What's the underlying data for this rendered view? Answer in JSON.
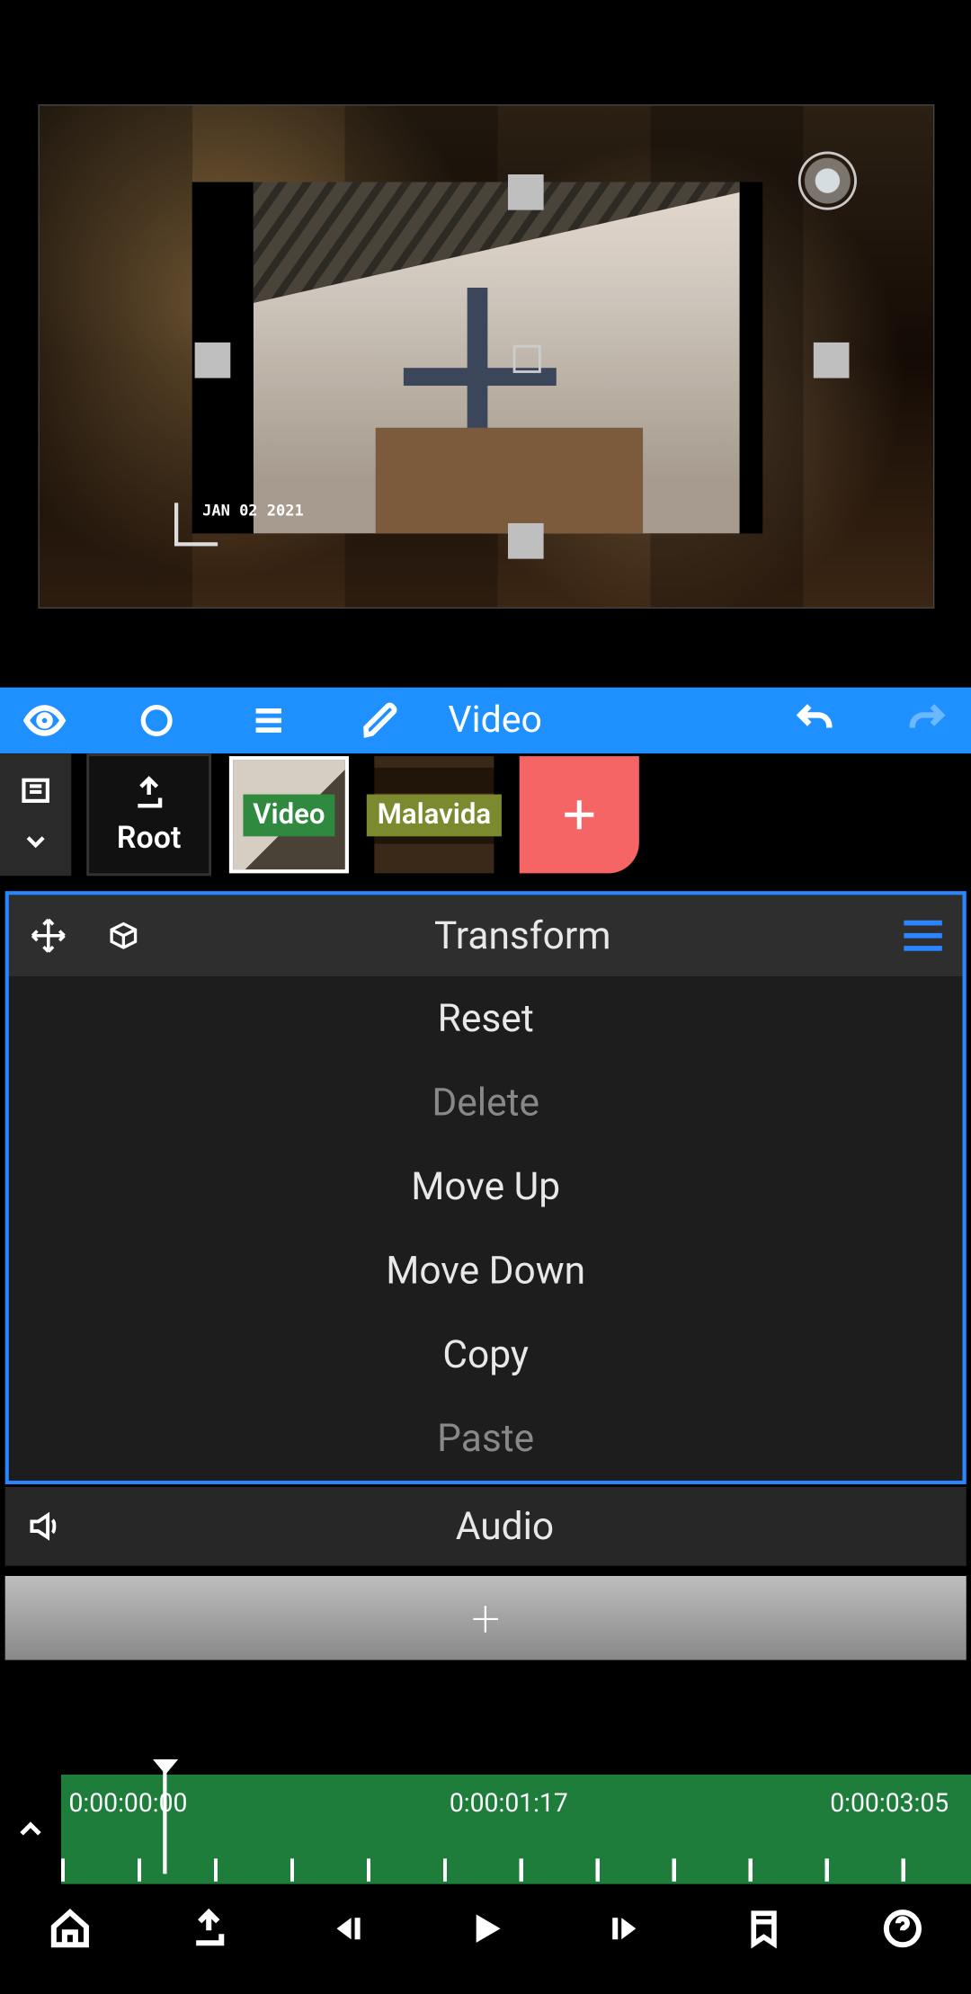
{
  "toolbar": {
    "title": "Video"
  },
  "layers": {
    "root_label": "Root",
    "thumbs": [
      {
        "label": "Video"
      },
      {
        "label": "Malavida"
      }
    ]
  },
  "transform_panel": {
    "title": "Transform",
    "items": [
      {
        "label": "Reset",
        "enabled": true
      },
      {
        "label": "Delete",
        "enabled": false
      },
      {
        "label": "Move Up",
        "enabled": true
      },
      {
        "label": "Move Down",
        "enabled": true
      },
      {
        "label": "Copy",
        "enabled": true
      },
      {
        "label": "Paste",
        "enabled": false
      }
    ]
  },
  "audio_row": {
    "label": "Audio"
  },
  "timeline": {
    "ticks": [
      "0:00:00:00",
      "0:00:01:17",
      "0:00:03:05"
    ]
  },
  "preview": {
    "watermark": "JAN 02 2021"
  }
}
